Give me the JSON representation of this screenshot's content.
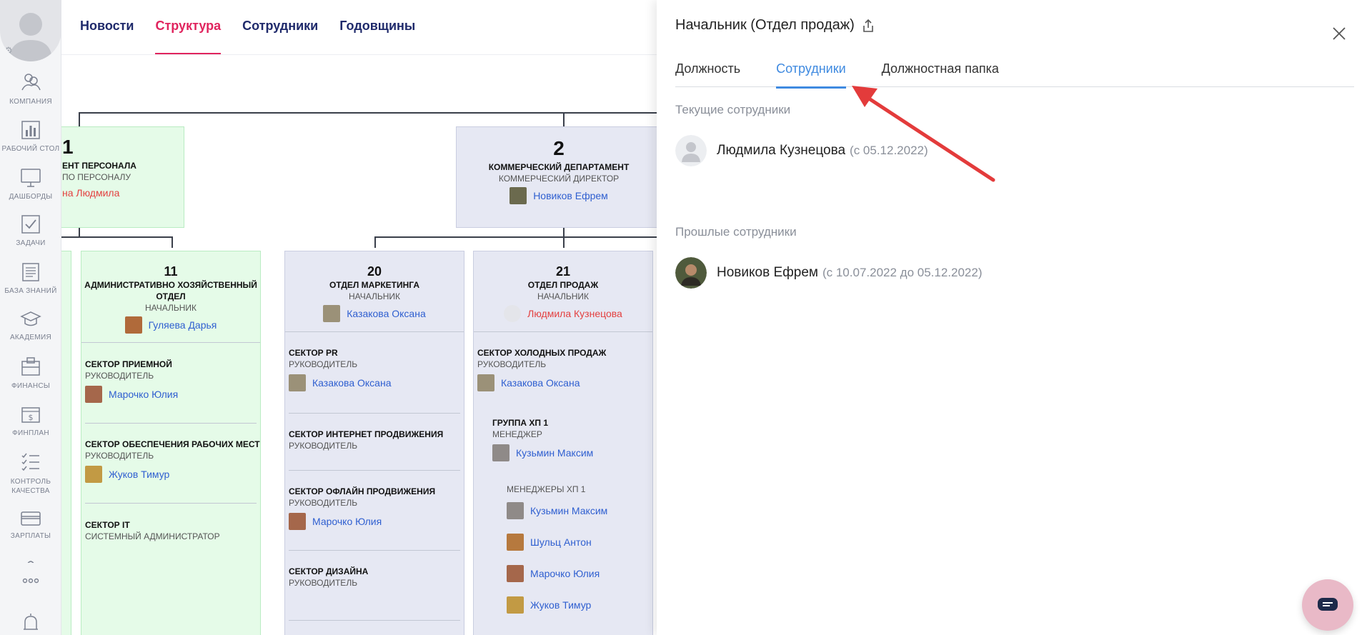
{
  "sidebar": {
    "items": [
      {
        "label": "КОМПАНИЯ",
        "icon": "company-icon"
      },
      {
        "label": "РАБОЧИЙ СТОЛ",
        "icon": "desk-chart-icon"
      },
      {
        "label": "ДАШБОРДЫ",
        "icon": "monitor-icon"
      },
      {
        "label": "ЗАДАЧИ",
        "icon": "checkbox-icon"
      },
      {
        "label": "БАЗА ЗНАНИЙ",
        "icon": "document-icon"
      },
      {
        "label": "АКАДЕМИЯ",
        "icon": "graduation-cap-icon"
      },
      {
        "label": "ФИНАНСЫ",
        "icon": "wallet-icon"
      },
      {
        "label": "ФИНПЛАН",
        "icon": "money-icon"
      },
      {
        "label": "КОНТРОЛЬ КАЧЕСТВА",
        "icon": "checklist-icon"
      },
      {
        "label": "ЗАРПЛАТЫ",
        "icon": "card-icon"
      }
    ]
  },
  "top_tabs": [
    "Новости",
    "Структура",
    "Сотрудники",
    "Годовщины"
  ],
  "chart": {
    "box1": {
      "num": "1",
      "dept": "ЕНТ ПЕРСОНАЛА",
      "role": "ПО ПЕРСОНАЛУ",
      "person": "на Людмила"
    },
    "box2": {
      "num": "2",
      "dept": "КОММЕРЧЕСКИЙ ДЕПАРТАМЕНТ",
      "role": "КОММЕРЧЕСКИЙ ДИРЕКТОР",
      "person": "Новиков Ефрем"
    },
    "box11": {
      "num": "11",
      "dept": "АДМИНИСТРАТИВНО ХОЗЯЙСТВЕННЫЙ ОТДЕЛ",
      "role": "НАЧАЛЬНИК",
      "person": "Гуляева Дарья",
      "sectors": [
        {
          "name": "СЕКТОР ПРИЕМНОЙ",
          "role": "РУКОВОДИТЕЛЬ",
          "person": "Марочко Юлия"
        },
        {
          "name": "СЕКТОР ОБЕСПЕЧЕНИЯ РАБОЧИХ МЕСТ",
          "role": "РУКОВОДИТЕЛЬ",
          "person": "Жуков Тимур"
        },
        {
          "name": "СЕКТОР IT",
          "role": "СИСТЕМНЫЙ АДМИНИСТРАТОР",
          "person": ""
        }
      ]
    },
    "box20": {
      "num": "20",
      "dept": "ОТДЕЛ МАРКЕТИНГА",
      "role": "НАЧАЛЬНИК",
      "person": "Казакова Оксана",
      "sectors": [
        {
          "name": "СЕКТОР PR",
          "role": "РУКОВОДИТЕЛЬ",
          "person": "Казакова Оксана"
        },
        {
          "name": "СЕКТОР ИНТЕРНЕТ ПРОДВИЖЕНИЯ",
          "role": "РУКОВОДИТЕЛЬ",
          "person": ""
        },
        {
          "name": "СЕКТОР ОФЛАЙН ПРОДВИЖЕНИЯ",
          "role": "РУКОВОДИТЕЛЬ",
          "person": "Марочко Юлия"
        },
        {
          "name": "СЕКТОР ДИЗАЙНА",
          "role": "РУКОВОДИТЕЛЬ",
          "person": ""
        }
      ]
    },
    "box21": {
      "num": "21",
      "dept": "ОТДЕЛ ПРОДАЖ",
      "role": "НАЧАЛЬНИК",
      "person": "Людмила Кузнецова",
      "sector": {
        "name": "СЕКТОР ХОЛОДНЫХ ПРОДАЖ",
        "role": "РУКОВОДИТЕЛЬ",
        "person": "Казакова Оксана"
      },
      "group": {
        "name": "ГРУППА ХП 1",
        "role": "МЕНЕДЖЕР",
        "person": "Кузьмин Максим"
      },
      "managers": {
        "label": "МЕНЕДЖЕРЫ ХП 1",
        "people": [
          "Кузьмин Максим",
          "Шульц Антон",
          "Марочко Юлия",
          "Жуков Тимур"
        ]
      }
    }
  },
  "panel": {
    "title": "Начальник (Отдел продаж)",
    "tabs": [
      "Должность",
      "Сотрудники",
      "Должностная папка"
    ],
    "current_label": "Текущие сотрудники",
    "current": {
      "name": "Людмила Кузнецова",
      "date": "(с 05.12.2022)"
    },
    "past_label": "Прошлые сотрудники",
    "past": {
      "name": "Новиков Ефрем",
      "date": "(с 10.07.2022 до 05.12.2022)"
    }
  },
  "colors": {
    "accent_pink": "#e0245e",
    "accent_blue": "#3f8ae0",
    "link_blue": "#2f5fd0",
    "arrow_red": "#e33b3b"
  }
}
